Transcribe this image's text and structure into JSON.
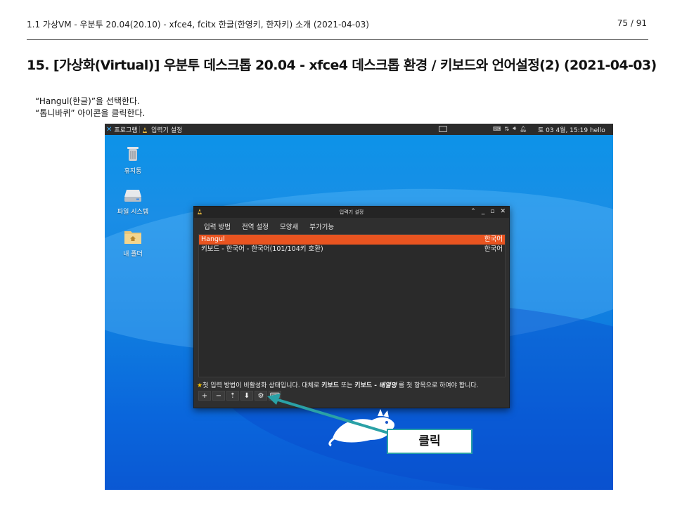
{
  "doc": {
    "header_left": "1.1 가상VM - 우분투 20.04(20.10) - xfce4, fcitx 한글(한영키, 한자키) 소개 (2021-04-03)",
    "page_indicator": "75 / 91",
    "title": "15. [가상화(Virtual)] 우분투 데스크톱 20.04 - xfce4 데스크톱 환경 / 키보드와 언어설정(2) (2021-04-03)",
    "instructions": [
      "“Hangul(한글)”을 선택한다.",
      "“톱니바퀴” 아이콘을 클릭한다."
    ]
  },
  "desktop": {
    "panel": {
      "menu_label": "프로그램",
      "task_label": "입력기 설정",
      "clock": "토 03  4월, 15:19  hello",
      "tray_icons": [
        "keyboard-icon",
        "network-icon",
        "volume-icon",
        "bell-icon"
      ]
    },
    "icons": [
      {
        "label": "휴지통",
        "icon": "trash-icon"
      },
      {
        "label": "파일 시스템",
        "icon": "drive-icon"
      },
      {
        "label": "내 폴더",
        "icon": "home-folder-icon"
      }
    ]
  },
  "window": {
    "title": "입력기 설정",
    "tabs": [
      "입력 방법",
      "전역 설정",
      "모양새",
      "부가기능"
    ],
    "active_tab": 0,
    "items": [
      {
        "name": "Hangul",
        "language": "한국어",
        "selected": true
      },
      {
        "name": "키보드 - 한국어 - 한국어(101/104키 호환)",
        "language": "한국어",
        "selected": false
      }
    ],
    "status": {
      "prefix": "첫 입력 방법이 비활성화 상태입니다. 대체로 ",
      "bold1": "키보드",
      "mid": " 또는 ",
      "bold2": "키보드 - ",
      "italic": "배열명",
      "suffix": " 를 첫 항목으로 하여야 합니다."
    },
    "buttons": [
      {
        "symbol": "+",
        "name": "add-button"
      },
      {
        "symbol": "−",
        "name": "remove-button"
      },
      {
        "symbol": "⇡",
        "name": "move-up-button"
      },
      {
        "symbol": "⬇",
        "name": "move-down-button"
      },
      {
        "symbol": "⚙",
        "name": "configure-gear-button"
      },
      {
        "symbol": "⌨",
        "name": "keyboard-layout-button"
      }
    ]
  },
  "callout": {
    "label": "클릭",
    "color": "#2aa1a6"
  },
  "colors": {
    "selection": "#e95420",
    "panel": "#2b2b2b",
    "desktop": "#0f7de0"
  }
}
